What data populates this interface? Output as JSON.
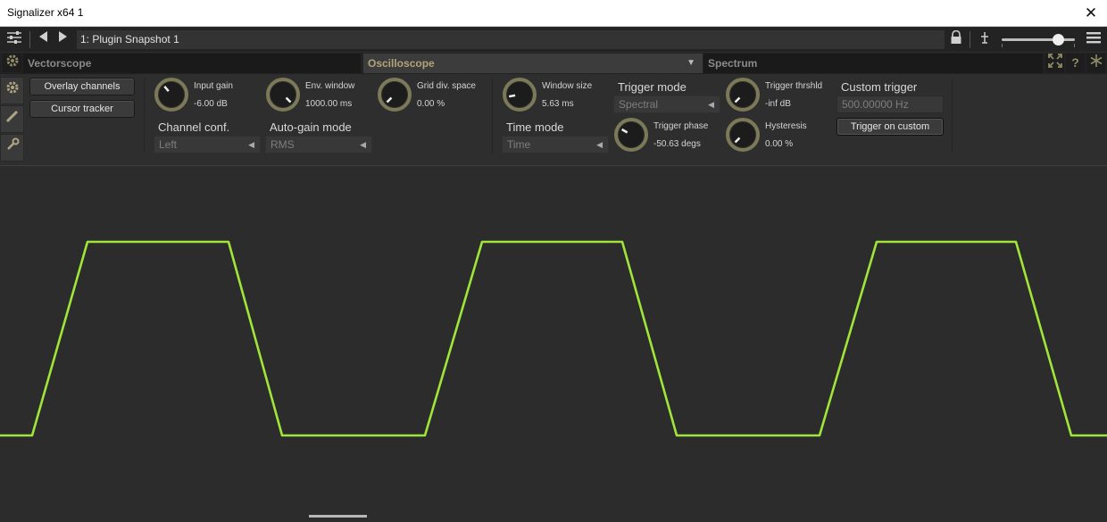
{
  "window": {
    "title": "Signalizer x64 1",
    "close_glyph": "✕"
  },
  "host": {
    "preset_name": "1: Plugin Snapshot 1",
    "zoom_level": 0.75
  },
  "tabs": [
    {
      "label": "Vectorscope"
    },
    {
      "label": "Oscilloscope",
      "dropdown": "▼"
    },
    {
      "label": "Spectrum"
    }
  ],
  "controls": {
    "overlay_channels": "Overlay channels",
    "cursor_tracker": "Cursor tracker",
    "input_gain": {
      "label": "Input gain",
      "value": "-6.00 dB"
    },
    "env_window": {
      "label": "Env. window",
      "value": "1000.00 ms"
    },
    "grid_div": {
      "label": "Grid div. space",
      "value": "0.00 %"
    },
    "channel_conf": {
      "label": "Channel conf.",
      "value": "Left"
    },
    "auto_gain": {
      "label": "Auto-gain mode",
      "value": "RMS"
    },
    "window_size": {
      "label": "Window size",
      "value": "5.63 ms"
    },
    "time_mode": {
      "label": "Time mode",
      "value": "Time"
    },
    "trigger_mode": {
      "label": "Trigger mode",
      "value": "Spectral"
    },
    "trigger_phase": {
      "label": "Trigger phase",
      "value": "-50.63 degs"
    },
    "trigger_thrshld": {
      "label": "Trigger thrshld",
      "value": "-inf dB"
    },
    "hysteresis": {
      "label": "Hysteresis",
      "value": "0.00 %"
    },
    "custom_trigger": {
      "label": "Custom trigger",
      "value": "500.00000 Hz"
    },
    "trigger_on_custom": "Trigger on custom"
  },
  "colors": {
    "waveform": "#9fe53a",
    "active_tab_text": "#b0a37a",
    "knob_arc": "#8a8660"
  },
  "waveform": {
    "period_px_hint": "three trapezoid cycles visible"
  }
}
